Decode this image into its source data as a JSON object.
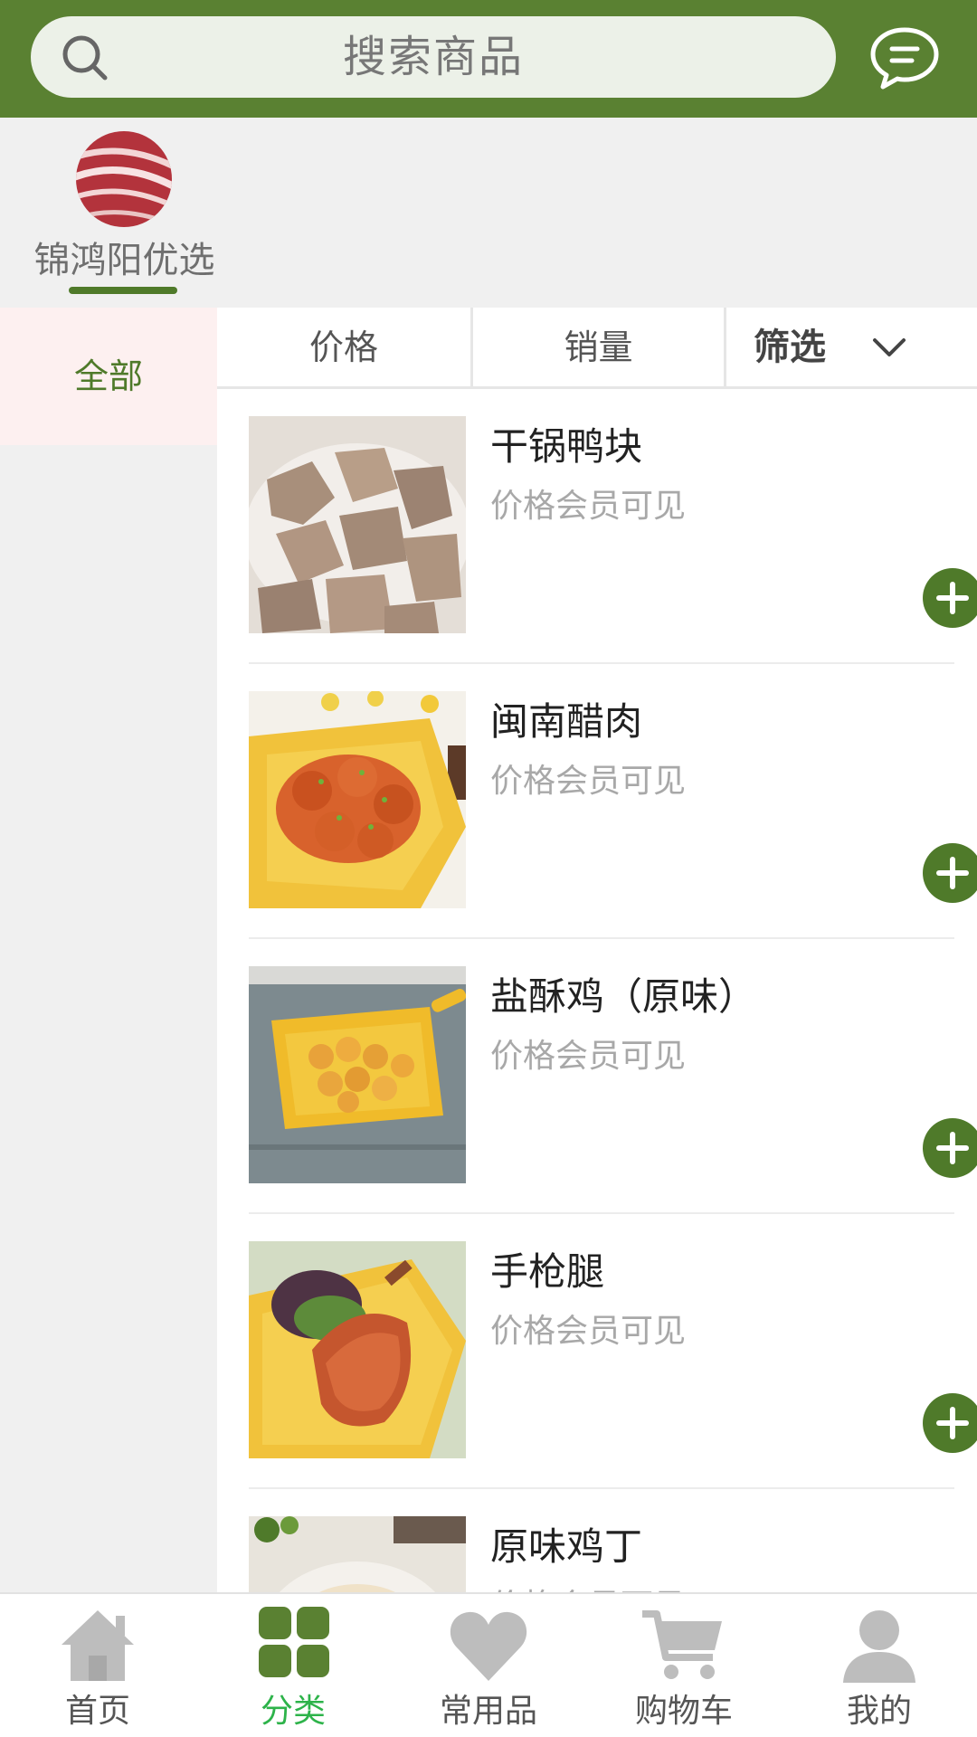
{
  "search": {
    "placeholder": "搜索商品",
    "icon": "search-icon",
    "message_icon": "chat-icon"
  },
  "store": {
    "name": "锦鸿阳优选",
    "avatar": "meat-avatar"
  },
  "categories": [
    {
      "label": "全部",
      "selected": true
    }
  ],
  "sort": {
    "price_label": "价格",
    "sales_label": "销量",
    "filter_label": "筛选"
  },
  "products": [
    {
      "name": "干锅鸭块",
      "price_text": "价格会员可见",
      "image": "braised-duck-chunks"
    },
    {
      "name": "闽南醋肉",
      "price_text": "价格会员可见",
      "image": "sweet-sour-pork"
    },
    {
      "name": "盐酥鸡（原味）",
      "price_text": "价格会员可见",
      "image": "salted-crispy-chicken"
    },
    {
      "name": "手枪腿",
      "price_text": "价格会员可见",
      "image": "roast-duck-leg"
    },
    {
      "name": "原味鸡丁",
      "price_text": "价格会员可见",
      "image": "chicken-cubes"
    }
  ],
  "nav": [
    {
      "label": "首页",
      "icon": "home-icon",
      "active": false
    },
    {
      "label": "分类",
      "icon": "grid-icon",
      "active": true
    },
    {
      "label": "常用品",
      "icon": "heart-icon",
      "active": false
    },
    {
      "label": "购物车",
      "icon": "cart-icon",
      "active": false
    },
    {
      "label": "我的",
      "icon": "user-icon",
      "active": false
    }
  ],
  "colors": {
    "brand_green": "#5a8132",
    "add_button": "#4f7a2a",
    "nav_active": "#2db34a"
  }
}
